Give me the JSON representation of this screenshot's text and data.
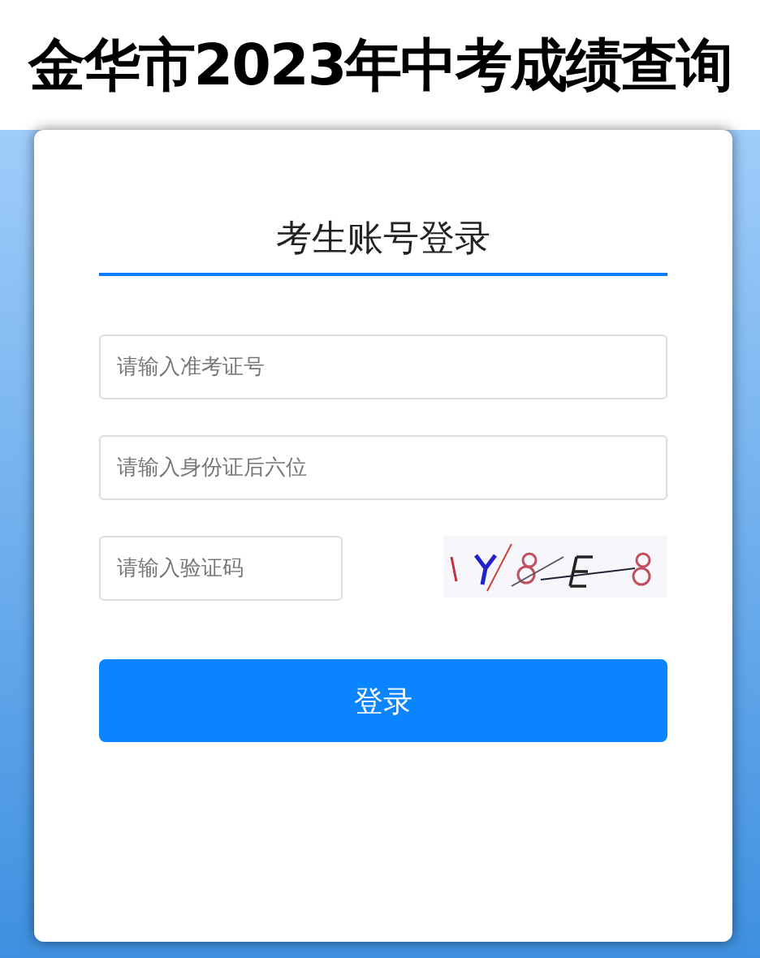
{
  "page_title": "金华市2023年中考成绩查询",
  "login": {
    "heading": "考生账号登录",
    "fields": [
      {
        "placeholder": "请输入准考证号",
        "kind": "full"
      },
      {
        "placeholder": "请输入身份证后六位",
        "kind": "full"
      },
      {
        "placeholder": "请输入验证码",
        "kind": "captcha"
      }
    ],
    "button": "登录"
  }
}
